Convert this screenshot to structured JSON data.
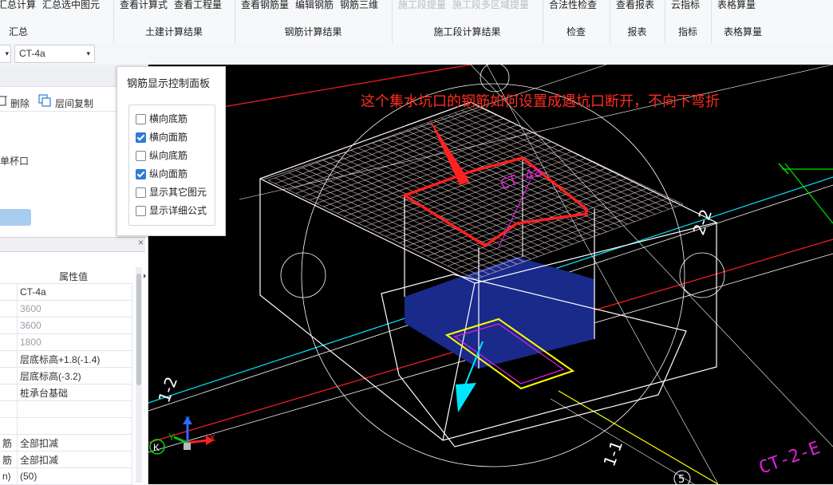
{
  "ribbon": {
    "groups": [
      {
        "label": "汇总",
        "buttons": [
          "汇总计算",
          "汇总选中图元"
        ],
        "enabled": true
      },
      {
        "label": "土建计算结果",
        "buttons": [
          "查看计算式",
          "查看工程量"
        ],
        "enabled": true
      },
      {
        "label": "钢筋计算结果",
        "buttons": [
          "查看钢筋量",
          "编辑钢筋",
          "钢筋三维"
        ],
        "enabled": true
      },
      {
        "label": "施工段计算结果",
        "buttons": [
          "施工段提量",
          "施工段多区域提量"
        ],
        "enabled": false
      },
      {
        "label": "检查",
        "buttons": [
          "合法性检查"
        ],
        "enabled": true
      },
      {
        "label": "报表",
        "buttons": [
          "查看报表"
        ],
        "enabled": true
      },
      {
        "label": "指标",
        "buttons": [
          "云指标"
        ],
        "enabled": true
      },
      {
        "label": "表格算量",
        "buttons": [
          "表格算量"
        ],
        "enabled": true
      }
    ]
  },
  "toolbar": {
    "element_select_value": "CT-4a"
  },
  "left_panel": {
    "tools": {
      "delete_label": "删除",
      "floor_copy_label": "层间复制"
    },
    "tree_item": "单杯口",
    "property_header": "属性值",
    "rows": [
      {
        "name": "",
        "value": "CT-4a",
        "muted": false
      },
      {
        "name": "",
        "value": "3600",
        "muted": true
      },
      {
        "name": "",
        "value": "3600",
        "muted": true
      },
      {
        "name": "",
        "value": "1800",
        "muted": true
      },
      {
        "name": "",
        "value": "层底标高+1.8(-1.4)",
        "muted": false
      },
      {
        "name": "",
        "value": "层底标高(-3.2)",
        "muted": false
      },
      {
        "name": "",
        "value": "桩承台基础",
        "muted": false
      },
      {
        "name": "",
        "value": "",
        "muted": false
      },
      {
        "name": "",
        "value": "",
        "muted": false
      },
      {
        "name": "筋",
        "value": "全部扣减",
        "muted": false
      },
      {
        "name": "筋",
        "value": "全部扣减",
        "muted": false
      },
      {
        "name": "n)",
        "value": "(50)",
        "muted": false
      }
    ]
  },
  "rebar_panel": {
    "title": "钢筋显示控制面板",
    "options": [
      {
        "label": "横向底筋",
        "checked": false
      },
      {
        "label": "横向面筋",
        "checked": true
      },
      {
        "label": "纵向底筋",
        "checked": false
      },
      {
        "label": "纵向面筋",
        "checked": true
      },
      {
        "label": "显示其它图元",
        "checked": false
      },
      {
        "label": "显示详细公式",
        "checked": false
      }
    ]
  },
  "viewport": {
    "annotation": "这个集水坑口的钢筋如何设置成遇坑口断开，不向下弯折",
    "axis_labels": {
      "x": "X",
      "y": "Y",
      "z": "Z",
      "k": "K"
    },
    "grid_labels": [
      "1-2",
      "1-1",
      "2-2",
      "5"
    ],
    "element_label": "CT-2-E",
    "pit_label": "CT-4a",
    "colors": {
      "background": "#000000",
      "wire": "#ffffff",
      "cyan_line": "#00e5ff",
      "red_line": "#ff2020",
      "magenta": "#e020e0",
      "green": "#00e000",
      "yellow": "#ffff00",
      "pit_fill": "#1a2a8a",
      "annotation": "#ff2d20"
    }
  }
}
